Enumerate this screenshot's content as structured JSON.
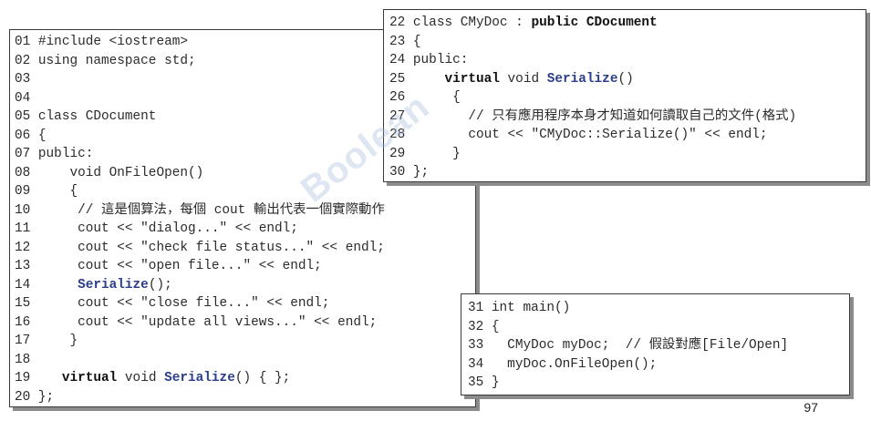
{
  "blocks": [
    {
      "id": "main-listing",
      "lines": [
        [
          {
            "t": "01 #include <iostream>"
          }
        ],
        [
          {
            "t": "02 using namespace std;"
          }
        ],
        [
          {
            "t": "03"
          }
        ],
        [
          {
            "t": "04"
          }
        ],
        [
          {
            "t": "05 class CDocument"
          }
        ],
        [
          {
            "t": "06 {"
          }
        ],
        [
          {
            "t": "07 public:"
          }
        ],
        [
          {
            "t": "08     void OnFileOpen()"
          }
        ],
        [
          {
            "t": "09     {"
          }
        ],
        [
          {
            "t": "10      // 這是個算法，每個 cout 輸出代表一個實際動作"
          }
        ],
        [
          {
            "t": "11      cout << \"dialog...\" << endl;"
          }
        ],
        [
          {
            "t": "12      cout << \"check file status...\" << endl;"
          }
        ],
        [
          {
            "t": "13      cout << \"open file...\" << endl;"
          }
        ],
        [
          {
            "t": "14      "
          },
          {
            "t": "Serialize",
            "s": "fn"
          },
          {
            "t": "();"
          }
        ],
        [
          {
            "t": "15      cout << \"close file...\" << endl;"
          }
        ],
        [
          {
            "t": "16      cout << \"update all views...\" << endl;"
          }
        ],
        [
          {
            "t": "17     }"
          }
        ],
        [
          {
            "t": "18"
          }
        ],
        [
          {
            "t": "19    "
          },
          {
            "t": "virtual",
            "s": "kw"
          },
          {
            "t": " void "
          },
          {
            "t": "Serialize",
            "s": "fn"
          },
          {
            "t": "() { };"
          }
        ],
        [
          {
            "t": "20 };"
          }
        ]
      ]
    },
    {
      "id": "derived-class",
      "lines": [
        [
          {
            "t": "22 class CMyDoc : "
          },
          {
            "t": "public CDocument",
            "s": "kw"
          }
        ],
        [
          {
            "t": "23 {"
          }
        ],
        [
          {
            "t": "24 public:"
          }
        ],
        [
          {
            "t": "25     "
          },
          {
            "t": "virtual",
            "s": "kw"
          },
          {
            "t": " void "
          },
          {
            "t": "Serialize",
            "s": "fn"
          },
          {
            "t": "()"
          }
        ],
        [
          {
            "t": "26      {"
          }
        ],
        [
          {
            "t": "27        // 只有應用程序本身才知道如何讀取自己的文件(格式)"
          }
        ],
        [
          {
            "t": "28        cout << \"CMyDoc::Serialize()\" << endl;"
          }
        ],
        [
          {
            "t": "29      }"
          }
        ],
        [
          {
            "t": "30 };"
          }
        ]
      ]
    },
    {
      "id": "main-function",
      "lines": [
        [
          {
            "t": "31 int main()"
          }
        ],
        [
          {
            "t": "32 {"
          }
        ],
        [
          {
            "t": "33   CMyDoc myDoc;  // 假設對應[File/Open]"
          }
        ],
        [
          {
            "t": "34   myDoc.OnFileOpen();"
          }
        ],
        [
          {
            "t": "35 }"
          }
        ]
      ]
    }
  ],
  "page_number": "97",
  "watermark": {
    "logo_text": "Boolean"
  },
  "colors": {
    "keyword": "#111111",
    "function_name": "#2c3e8c",
    "text": "#2b2b2b",
    "box_border": "#3a3a3a",
    "shadow": "#8c8c8c"
  }
}
